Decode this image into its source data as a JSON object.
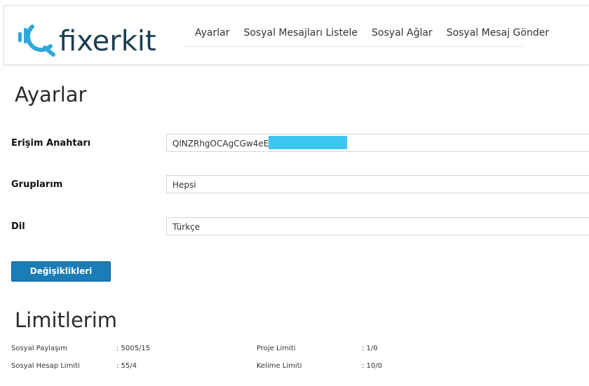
{
  "brand": {
    "name": "fixerkit",
    "color": "#1b3e4f",
    "accent": "#2fa8d9"
  },
  "nav": {
    "items": [
      "Ayarlar",
      "Sosyal Mesajları Listele",
      "Sosyal Ağlar",
      "Sosyal Mesaj Gönder"
    ]
  },
  "settings": {
    "title": "Ayarlar",
    "access_key": {
      "label": "Erişim Anahtarı",
      "value": "QlNZRhgOCAgCGw4eE"
    },
    "groups": {
      "label": "Gruplarım",
      "value": "Hepsi"
    },
    "language": {
      "label": "Dil",
      "value": "Türkçe"
    },
    "save_label": "Değişiklikleri Kaydet"
  },
  "limits": {
    "title": "Limitlerim",
    "rows": [
      {
        "label": "Sosyal Paylaşım",
        "value": ": 5005/15"
      },
      {
        "label": "Proje Limiti",
        "value": ": 1/0"
      },
      {
        "label": "Sosyal Hesap Limiti",
        "value": ": 55/4"
      },
      {
        "label": "Kelime Limiti",
        "value": ": 10/0"
      }
    ]
  }
}
